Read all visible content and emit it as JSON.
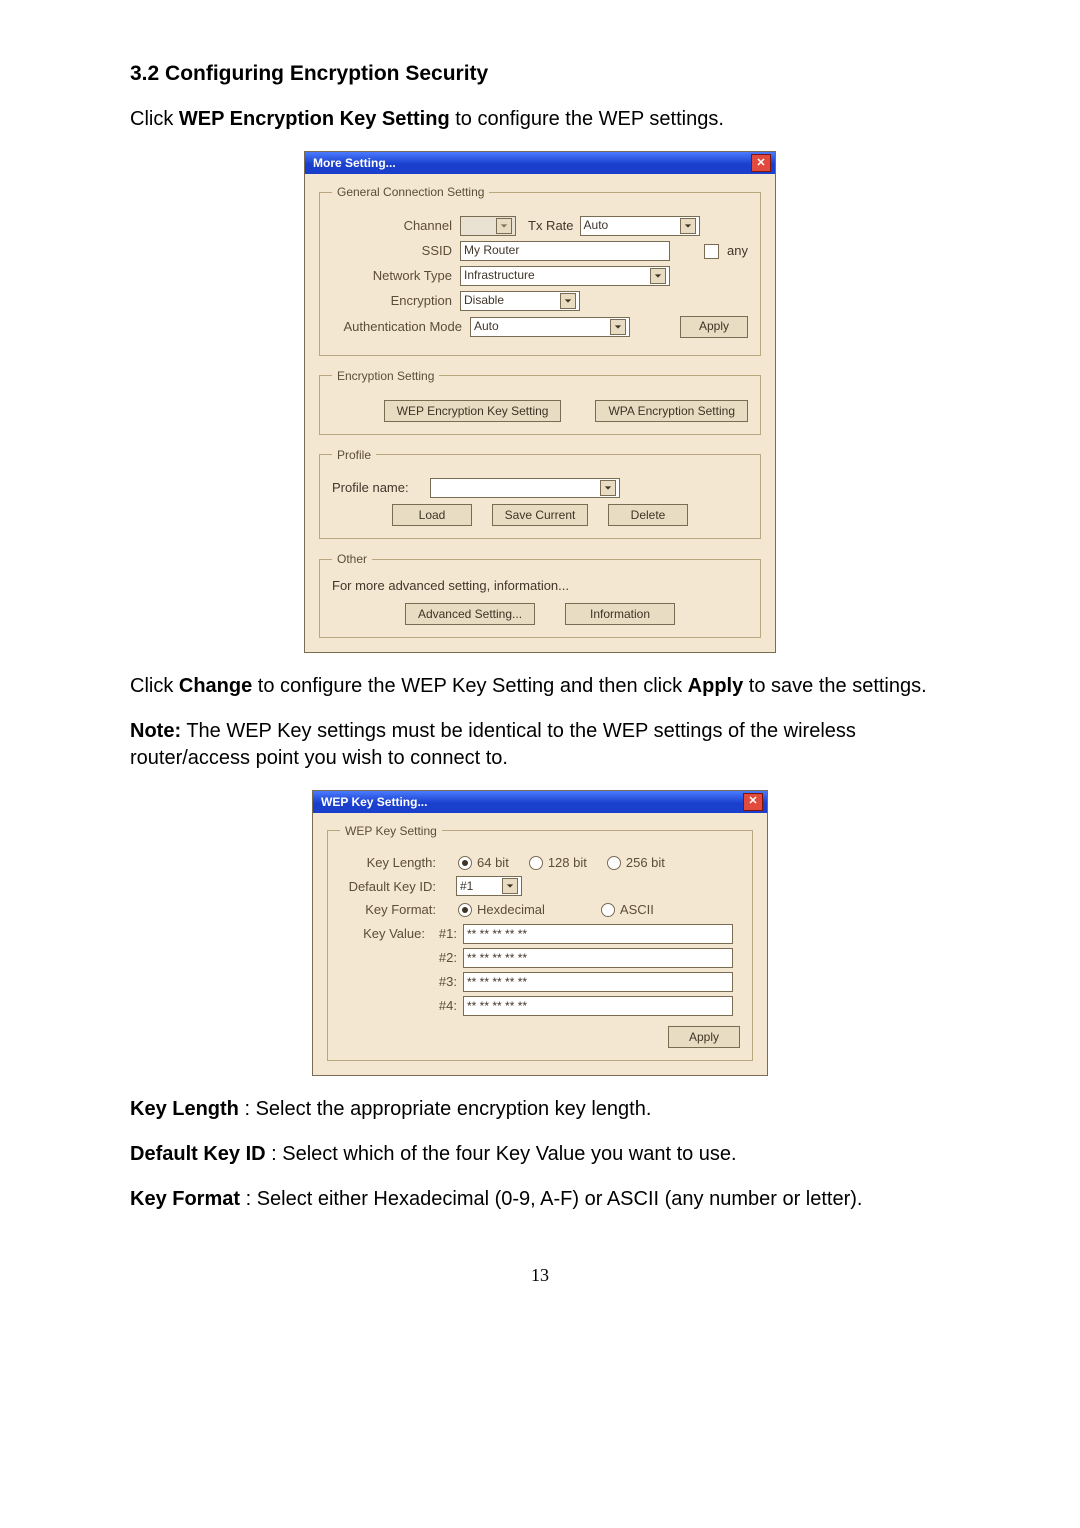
{
  "doc": {
    "section_heading": "3.2 Configuring Encryption Security",
    "p1_a": "Click ",
    "p1_b": "WEP Encryption Key Setting",
    "p1_c": " to configure the WEP settings.",
    "p2_a": "Click ",
    "p2_b": "Change",
    "p2_c": " to configure the WEP Key Setting and then click ",
    "p2_d": "Apply",
    "p2_e": " to save the settings.",
    "p3_a": "Note:",
    "p3_b": " The WEP Key settings must be identical to the WEP settings of the wireless router/access point you wish to connect to.",
    "kl_a": "Key Length",
    "kl_b": ": Select the appropriate encryption key length.",
    "dk_a": "Default Key ID",
    "dk_b": ": Select which of the four Key Value you want to use.",
    "kf_a": "Key Format",
    "kf_b": ": Select either Hexadecimal (0-9, A-F) or ASCII (any number or letter).",
    "page_num": "13"
  },
  "more_dialog": {
    "title": "More Setting...",
    "close_glyph": "✕",
    "gcs": {
      "legend": "General Connection Setting",
      "channel_label": "Channel",
      "tx_rate_label": "Tx Rate",
      "tx_rate_value": "Auto",
      "ssid_label": "SSID",
      "ssid_value": "My Router",
      "any_label": "any",
      "ntype_label": "Network Type",
      "ntype_value": "Infrastructure",
      "enc_label": "Encryption",
      "enc_value": "Disable",
      "auth_label": "Authentication Mode",
      "auth_value": "Auto",
      "apply_btn": "Apply"
    },
    "encset": {
      "legend": "Encryption Setting",
      "wep_btn": "WEP Encryption Key Setting",
      "wpa_btn": "WPA Encryption Setting"
    },
    "profile": {
      "legend": "Profile",
      "name_label": "Profile name:",
      "load_btn": "Load",
      "save_btn": "Save Current",
      "del_btn": "Delete"
    },
    "other": {
      "legend": "Other",
      "text": "For more advanced setting, information...",
      "adv_btn": "Advanced Setting...",
      "info_btn": "Information"
    }
  },
  "wep_dialog": {
    "title": "WEP Key Setting...",
    "close_glyph": "✕",
    "legend": "WEP Key Setting",
    "key_length_label": "Key Length:",
    "opt_64": "64 bit",
    "opt_128": "128 bit",
    "opt_256": "256 bit",
    "default_id_label": "Default Key ID:",
    "default_id_value": "#1",
    "key_format_label": "Key Format:",
    "fmt_hex": "Hexdecimal",
    "fmt_ascii": "ASCII",
    "key_value_label": "Key Value:",
    "idx1": "#1:",
    "idx2": "#2:",
    "idx3": "#3:",
    "idx4": "#4:",
    "mask": "** ** ** ** **",
    "apply_btn": "Apply"
  }
}
